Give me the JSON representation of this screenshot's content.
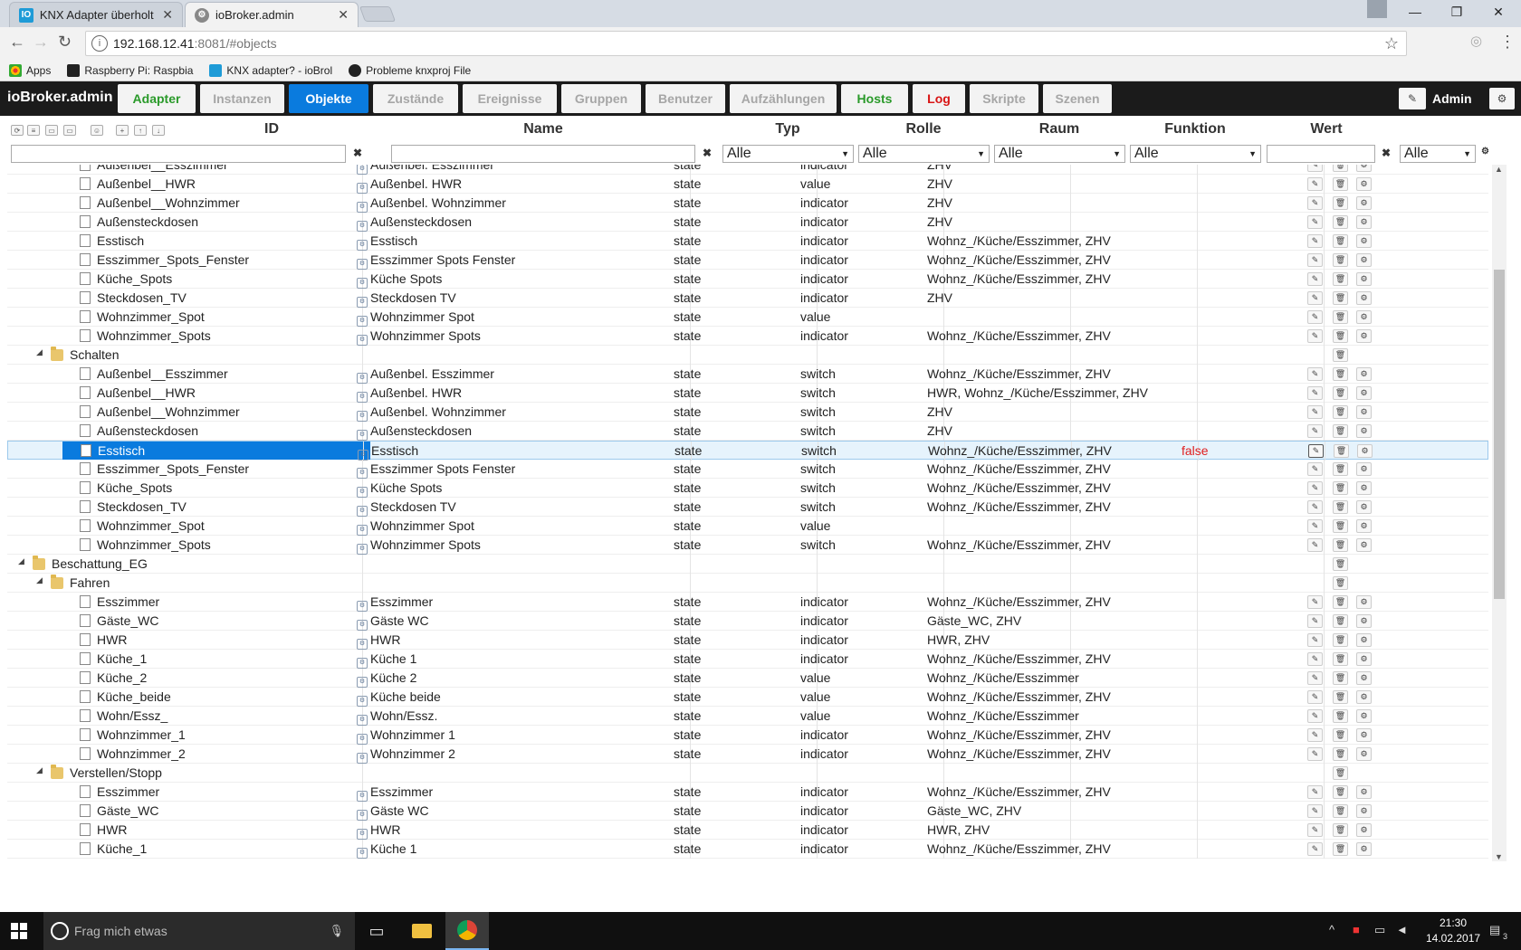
{
  "browser": {
    "tabs": [
      {
        "title": "KNX Adapter überholt - i",
        "active": false
      },
      {
        "title": "ioBroker.admin",
        "active": true
      }
    ],
    "url_host": "192.168.12.41",
    "url_rest": ":8081/#objects",
    "bookmarks": [
      {
        "label": "Apps",
        "icon": "apps-grid-icon"
      },
      {
        "label": "Raspberry Pi: Raspbia",
        "icon": "raspberry-icon"
      },
      {
        "label": "KNX adapter? - ioBrol",
        "icon": "iobroker-icon"
      },
      {
        "label": "Probleme knxproj File",
        "icon": "github-icon"
      }
    ]
  },
  "app": {
    "brand": "ioBroker.admin",
    "user": "Admin",
    "tabs": [
      {
        "label": "Adapter",
        "style": "green"
      },
      {
        "label": "Instanzen",
        "style": "normal"
      },
      {
        "label": "Objekte",
        "style": "active"
      },
      {
        "label": "Zustände",
        "style": "normal"
      },
      {
        "label": "Ereignisse",
        "style": "normal"
      },
      {
        "label": "Gruppen",
        "style": "normal"
      },
      {
        "label": "Benutzer",
        "style": "normal"
      },
      {
        "label": "Aufzählungen",
        "style": "normal"
      },
      {
        "label": "Hosts",
        "style": "green"
      },
      {
        "label": "Log",
        "style": "red"
      },
      {
        "label": "Skripte",
        "style": "normal"
      },
      {
        "label": "Szenen",
        "style": "normal"
      }
    ]
  },
  "grid": {
    "columns": {
      "id": "ID",
      "name": "Name",
      "typ": "Typ",
      "rolle": "Rolle",
      "raum": "Raum",
      "funktion": "Funktion",
      "wert": "Wert"
    },
    "filter_all": "Alle",
    "rows": [
      {
        "level": 3,
        "kind": "state",
        "id": "Außenbel__Esszimmer",
        "name": "Außenbel. Esszimmer",
        "typ": "state",
        "rolle": "indicator",
        "raum": "ZHV",
        "wert": ""
      },
      {
        "level": 3,
        "kind": "state",
        "id": "Außenbel__HWR",
        "name": "Außenbel. HWR",
        "typ": "state",
        "rolle": "value",
        "raum": "ZHV",
        "wert": ""
      },
      {
        "level": 3,
        "kind": "state",
        "id": "Außenbel__Wohnzimmer",
        "name": "Außenbel. Wohnzimmer",
        "typ": "state",
        "rolle": "indicator",
        "raum": "ZHV",
        "wert": ""
      },
      {
        "level": 3,
        "kind": "state",
        "id": "Außensteckdosen",
        "name": "Außensteckdosen",
        "typ": "state",
        "rolle": "indicator",
        "raum": "ZHV",
        "wert": ""
      },
      {
        "level": 3,
        "kind": "state",
        "id": "Esstisch",
        "name": "Esstisch",
        "typ": "state",
        "rolle": "indicator",
        "raum": "Wohnz_/Küche/Esszimmer, ZHV",
        "wert": ""
      },
      {
        "level": 3,
        "kind": "state",
        "id": "Esszimmer_Spots_Fenster",
        "name": "Esszimmer Spots Fenster",
        "typ": "state",
        "rolle": "indicator",
        "raum": "Wohnz_/Küche/Esszimmer, ZHV",
        "wert": ""
      },
      {
        "level": 3,
        "kind": "state",
        "id": "Küche_Spots",
        "name": "Küche Spots",
        "typ": "state",
        "rolle": "indicator",
        "raum": "Wohnz_/Küche/Esszimmer, ZHV",
        "wert": ""
      },
      {
        "level": 3,
        "kind": "state",
        "id": "Steckdosen_TV",
        "name": "Steckdosen TV",
        "typ": "state",
        "rolle": "indicator",
        "raum": "ZHV",
        "wert": ""
      },
      {
        "level": 3,
        "kind": "state",
        "id": "Wohnzimmer_Spot",
        "name": "Wohnzimmer Spot",
        "typ": "state",
        "rolle": "value",
        "raum": "",
        "wert": ""
      },
      {
        "level": 3,
        "kind": "state",
        "id": "Wohnzimmer_Spots",
        "name": "Wohnzimmer Spots",
        "typ": "state",
        "rolle": "indicator",
        "raum": "Wohnz_/Küche/Esszimmer, ZHV",
        "wert": ""
      },
      {
        "level": 2,
        "kind": "folder",
        "id": "Schalten"
      },
      {
        "level": 3,
        "kind": "state",
        "id": "Außenbel__Esszimmer",
        "name": "Außenbel. Esszimmer",
        "typ": "state",
        "rolle": "switch",
        "raum": "Wohnz_/Küche/Esszimmer, ZHV",
        "wert": ""
      },
      {
        "level": 3,
        "kind": "state",
        "id": "Außenbel__HWR",
        "name": "Außenbel. HWR",
        "typ": "state",
        "rolle": "switch",
        "raum": "HWR, Wohnz_/Küche/Esszimmer, ZHV",
        "wert": ""
      },
      {
        "level": 3,
        "kind": "state",
        "id": "Außenbel__Wohnzimmer",
        "name": "Außenbel. Wohnzimmer",
        "typ": "state",
        "rolle": "switch",
        "raum": "ZHV",
        "wert": ""
      },
      {
        "level": 3,
        "kind": "state",
        "id": "Außensteckdosen",
        "name": "Außensteckdosen",
        "typ": "state",
        "rolle": "switch",
        "raum": "ZHV",
        "wert": ""
      },
      {
        "level": 3,
        "kind": "state",
        "id": "Esstisch",
        "name": "Esstisch",
        "typ": "state",
        "rolle": "switch",
        "raum": "Wohnz_/Küche/Esszimmer, ZHV",
        "wert": "false",
        "selected": true
      },
      {
        "level": 3,
        "kind": "state",
        "id": "Esszimmer_Spots_Fenster",
        "name": "Esszimmer Spots Fenster",
        "typ": "state",
        "rolle": "switch",
        "raum": "Wohnz_/Küche/Esszimmer, ZHV",
        "wert": ""
      },
      {
        "level": 3,
        "kind": "state",
        "id": "Küche_Spots",
        "name": "Küche Spots",
        "typ": "state",
        "rolle": "switch",
        "raum": "Wohnz_/Küche/Esszimmer, ZHV",
        "wert": ""
      },
      {
        "level": 3,
        "kind": "state",
        "id": "Steckdosen_TV",
        "name": "Steckdosen TV",
        "typ": "state",
        "rolle": "switch",
        "raum": "Wohnz_/Küche/Esszimmer, ZHV",
        "wert": ""
      },
      {
        "level": 3,
        "kind": "state",
        "id": "Wohnzimmer_Spot",
        "name": "Wohnzimmer Spot",
        "typ": "state",
        "rolle": "value",
        "raum": "",
        "wert": ""
      },
      {
        "level": 3,
        "kind": "state",
        "id": "Wohnzimmer_Spots",
        "name": "Wohnzimmer Spots",
        "typ": "state",
        "rolle": "switch",
        "raum": "Wohnz_/Küche/Esszimmer, ZHV",
        "wert": ""
      },
      {
        "level": 1,
        "kind": "folder",
        "id": "Beschattung_EG"
      },
      {
        "level": 2,
        "kind": "folder",
        "id": "Fahren"
      },
      {
        "level": 3,
        "kind": "state",
        "id": "Esszimmer",
        "name": "Esszimmer",
        "typ": "state",
        "rolle": "indicator",
        "raum": "Wohnz_/Küche/Esszimmer, ZHV",
        "wert": ""
      },
      {
        "level": 3,
        "kind": "state",
        "id": "Gäste_WC",
        "name": "Gäste WC",
        "typ": "state",
        "rolle": "indicator",
        "raum": "Gäste_WC, ZHV",
        "wert": ""
      },
      {
        "level": 3,
        "kind": "state",
        "id": "HWR",
        "name": "HWR",
        "typ": "state",
        "rolle": "indicator",
        "raum": "HWR, ZHV",
        "wert": ""
      },
      {
        "level": 3,
        "kind": "state",
        "id": "Küche_1",
        "name": "Küche 1",
        "typ": "state",
        "rolle": "indicator",
        "raum": "Wohnz_/Küche/Esszimmer, ZHV",
        "wert": ""
      },
      {
        "level": 3,
        "kind": "state",
        "id": "Küche_2",
        "name": "Küche 2",
        "typ": "state",
        "rolle": "value",
        "raum": "Wohnz_/Küche/Esszimmer",
        "wert": ""
      },
      {
        "level": 3,
        "kind": "state",
        "id": "Küche_beide",
        "name": "Küche beide",
        "typ": "state",
        "rolle": "value",
        "raum": "Wohnz_/Küche/Esszimmer, ZHV",
        "wert": ""
      },
      {
        "level": 3,
        "kind": "state",
        "id": "Wohn/Essz_",
        "name": "Wohn/Essz.",
        "typ": "state",
        "rolle": "value",
        "raum": "Wohnz_/Küche/Esszimmer",
        "wert": ""
      },
      {
        "level": 3,
        "kind": "state",
        "id": "Wohnzimmer_1",
        "name": "Wohnzimmer 1",
        "typ": "state",
        "rolle": "indicator",
        "raum": "Wohnz_/Küche/Esszimmer, ZHV",
        "wert": ""
      },
      {
        "level": 3,
        "kind": "state",
        "id": "Wohnzimmer_2",
        "name": "Wohnzimmer 2",
        "typ": "state",
        "rolle": "indicator",
        "raum": "Wohnz_/Küche/Esszimmer, ZHV",
        "wert": ""
      },
      {
        "level": 2,
        "kind": "folder",
        "id": "Verstellen/Stopp"
      },
      {
        "level": 3,
        "kind": "state",
        "id": "Esszimmer",
        "name": "Esszimmer",
        "typ": "state",
        "rolle": "indicator",
        "raum": "Wohnz_/Küche/Esszimmer, ZHV",
        "wert": ""
      },
      {
        "level": 3,
        "kind": "state",
        "id": "Gäste_WC",
        "name": "Gäste WC",
        "typ": "state",
        "rolle": "indicator",
        "raum": "Gäste_WC, ZHV",
        "wert": ""
      },
      {
        "level": 3,
        "kind": "state",
        "id": "HWR",
        "name": "HWR",
        "typ": "state",
        "rolle": "indicator",
        "raum": "HWR, ZHV",
        "wert": ""
      },
      {
        "level": 3,
        "kind": "state",
        "id": "Küche_1",
        "name": "Küche 1",
        "typ": "state",
        "rolle": "indicator",
        "raum": "Wohnz_/Küche/Esszimmer, ZHV",
        "wert": ""
      }
    ]
  },
  "taskbar": {
    "search_placeholder": "Frag mich etwas",
    "time": "21:30",
    "date": "14.02.2017",
    "notifications": "3"
  }
}
